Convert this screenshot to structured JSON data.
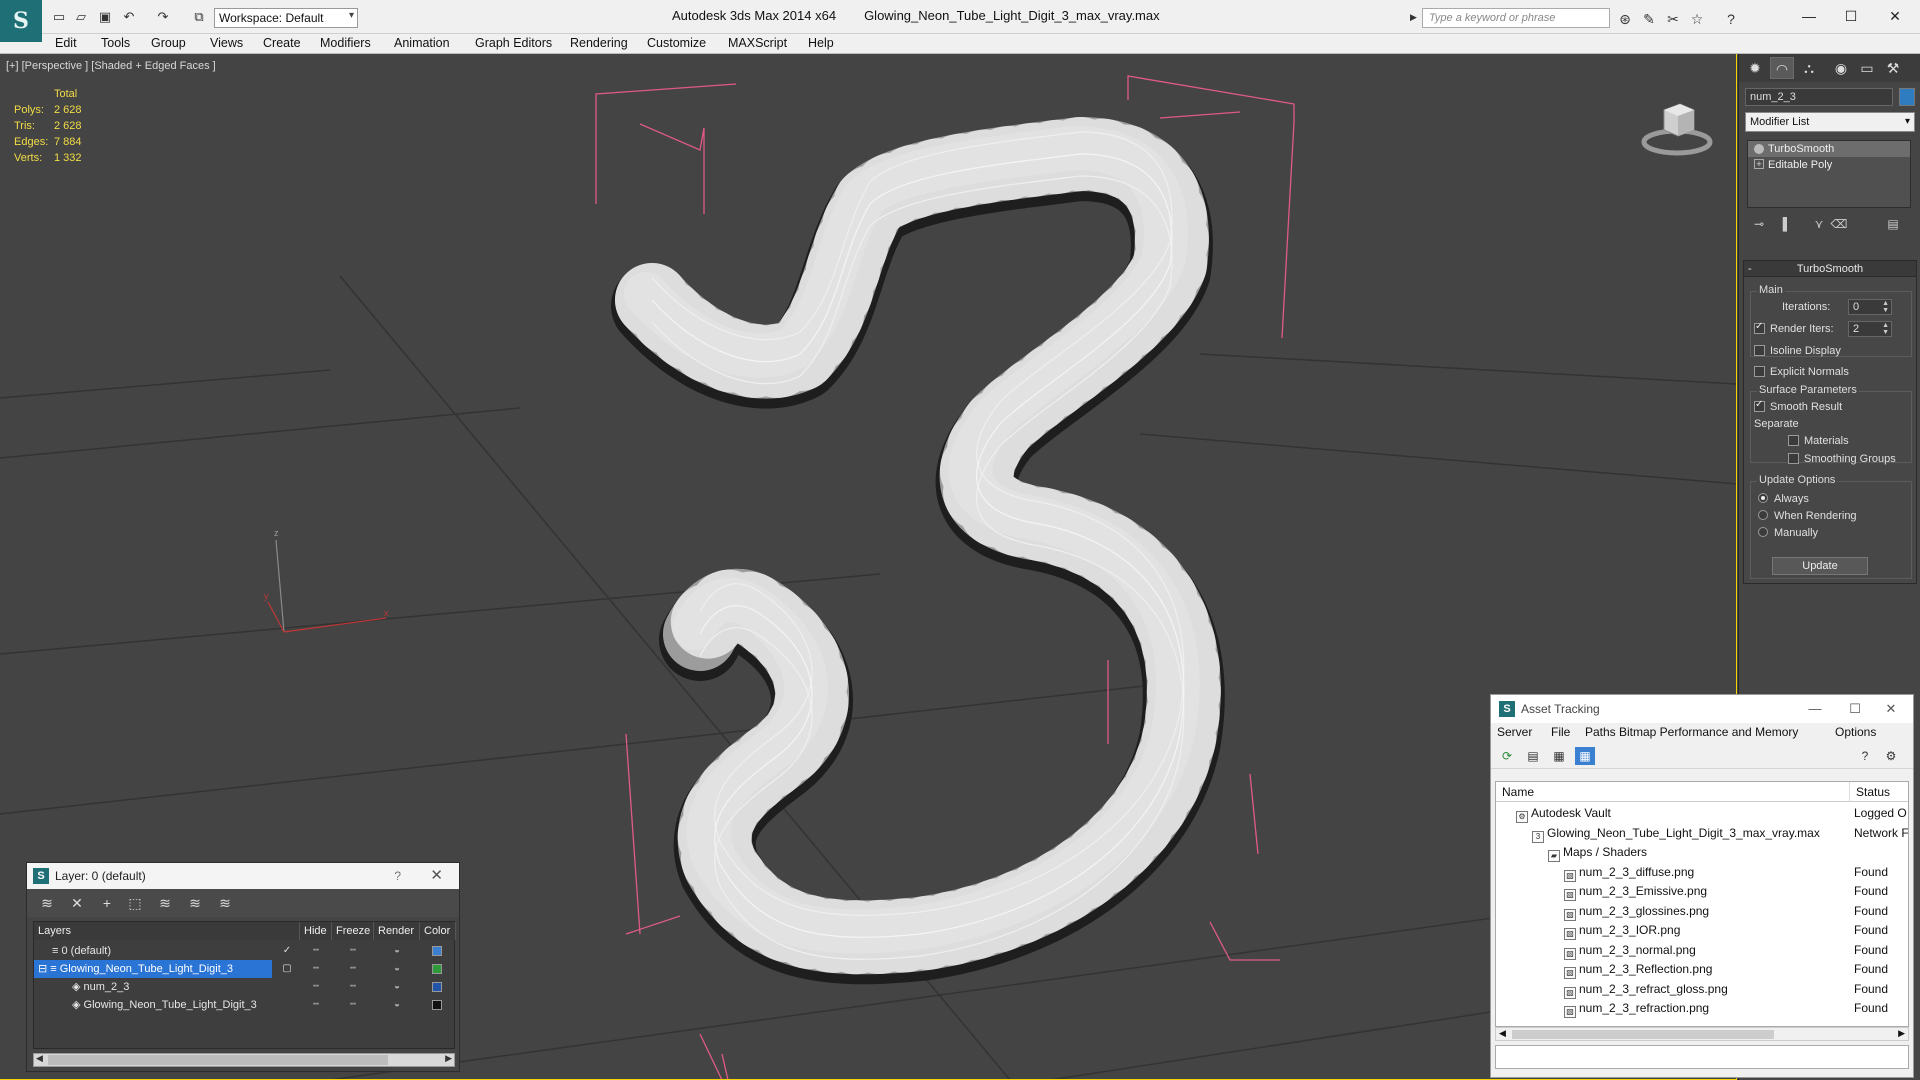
{
  "app": {
    "logo_letter": "S",
    "workspace_label": "Workspace: Default",
    "title_app": "Autodesk 3ds Max  2014 x64",
    "title_file": "Glowing_Neon_Tube_Light_Digit_3_max_vray.max",
    "search_placeholder": "Type a keyword or phrase"
  },
  "menu": [
    "Edit",
    "Tools",
    "Group",
    "Views",
    "Create",
    "Modifiers",
    "Animation",
    "Graph Editors",
    "Rendering",
    "Customize",
    "MAXScript",
    "Help"
  ],
  "viewport": {
    "label": "[+] [Perspective ] [Shaded + Edged Faces ]",
    "stats_header": "Total",
    "stats": [
      {
        "k": "Polys:",
        "v": "2 628"
      },
      {
        "k": "Tris:",
        "v": "2 628"
      },
      {
        "k": "Edges:",
        "v": "7 884"
      },
      {
        "k": "Verts:",
        "v": "1 332"
      }
    ],
    "axis_labels": {
      "x": "x",
      "y": "y",
      "z": "z"
    },
    "colors": {
      "background": "#444444",
      "grid": "#333333",
      "wire": "#e9e9e9",
      "bbox": "#ff6ea0",
      "selection": "#f5d500"
    }
  },
  "command_panel": {
    "object_name": "num_2_3",
    "object_color": "#2f7cc0",
    "modifier_list_label": "Modifier List",
    "stack": [
      {
        "label": "TurboSmooth",
        "selected": true
      },
      {
        "label": "Editable Poly",
        "selected": false
      }
    ],
    "rollout": {
      "title": "TurboSmooth",
      "main_label": "Main",
      "iterations_label": "Iterations:",
      "iterations_value": "0",
      "render_iters_label": "Render Iters:",
      "render_iters_value": "2",
      "isoline_label": "Isoline Display",
      "explicit_normals_label": "Explicit Normals",
      "surface_params_label": "Surface Parameters",
      "smooth_result_label": "Smooth Result",
      "separate_label": "Separate",
      "materials_label": "Materials",
      "smoothing_groups_label": "Smoothing Groups",
      "update_options_label": "Update Options",
      "always_label": "Always",
      "when_rendering_label": "When Rendering",
      "manually_label": "Manually",
      "update_button": "Update"
    }
  },
  "layer_dialog": {
    "title": "Layer: 0 (default)",
    "help": "?",
    "columns": {
      "layers": "Layers",
      "hide": "Hide",
      "freeze": "Freeze",
      "render": "Render",
      "color": "Color"
    },
    "rows": [
      {
        "name": "0 (default)",
        "indent": 0,
        "selected": false,
        "color": "#3a7fd0"
      },
      {
        "name": "Glowing_Neon_Tube_Light_Digit_3",
        "indent": 0,
        "selected": true,
        "color": "#2e9a3a"
      },
      {
        "name": "num_2_3",
        "indent": 1,
        "selected": false,
        "color": "#2255aa"
      },
      {
        "name": "Glowing_Neon_Tube_Light_Digit_3",
        "indent": 1,
        "selected": false,
        "color": "#111111"
      }
    ]
  },
  "asset_dialog": {
    "title": "Asset Tracking",
    "menu": [
      "Server",
      "File",
      "Paths",
      "Bitmap Performance and Memory",
      "Options"
    ],
    "columns": {
      "name": "Name",
      "status": "Status"
    },
    "rows": [
      {
        "name": "Autodesk Vault",
        "indent": 1,
        "status": "Logged O"
      },
      {
        "name": "Glowing_Neon_Tube_Light_Digit_3_max_vray.max",
        "indent": 2,
        "status": "Network F"
      },
      {
        "name": "Maps / Shaders",
        "indent": 3,
        "status": ""
      },
      {
        "name": "num_2_3_diffuse.png",
        "indent": 4,
        "status": "Found"
      },
      {
        "name": "num_2_3_Emissive.png",
        "indent": 4,
        "status": "Found"
      },
      {
        "name": "num_2_3_glossines.png",
        "indent": 4,
        "status": "Found"
      },
      {
        "name": "num_2_3_IOR.png",
        "indent": 4,
        "status": "Found"
      },
      {
        "name": "num_2_3_normal.png",
        "indent": 4,
        "status": "Found"
      },
      {
        "name": "num_2_3_Reflection.png",
        "indent": 4,
        "status": "Found"
      },
      {
        "name": "num_2_3_refract_gloss.png",
        "indent": 4,
        "status": "Found"
      },
      {
        "name": "num_2_3_refraction.png",
        "indent": 4,
        "status": "Found"
      }
    ]
  }
}
